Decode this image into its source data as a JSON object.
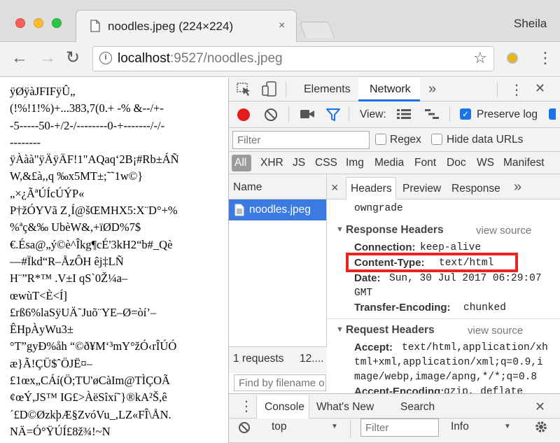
{
  "window": {
    "tab_title": "noodles.jpeg (224×224)",
    "tab_close": "×",
    "profile": "Sheila"
  },
  "toolbar": {
    "back": "←",
    "forward": "→",
    "reload": "↻",
    "url_host": "localhost",
    "url_rest": ":9527/noodles.jpeg",
    "star": "☆",
    "menu": "⋮",
    "info_icon": "i"
  },
  "page": {
    "lines": [
      "ÿØÿàJFIFÿÛ„",
      "(!%!1!%)+...383,7(0.+  -%  &--/+-",
      "-5-----50-+/2-/--------0-+-------/-/-",
      "--------",
      "ÿÀàà\"ÿÄÿÄF!1\"AQaq‘2B¡#Rb±ÁÑ",
      "W,&£à,,q ‰x5MT±;˜˜1w©}",
      "„×¿ÃªÚÍcÚÝP«",
      "P†žÓYVã  Z¸Í@šŒMHX5:X¨D°+%",
      "%ªç&‰  UbèW&,+ïØD%7$",
      "€.Ésa@„ý©è^Îkg¶cÉ'3kH2“b#_Qè",
      "—#Ïkd“R–ÅzÔH êj‡LÑ",
      "H¨”R*™ .V±I  qS`0Ž¼a–",
      "œwùT<È<Í]",
      "£rß6%laSÿUÄ˜Juõ¨YE–Ø=òí’–",
      "ÊHpÀyWu3±",
      "°T”gyÐ%åh  “©ð¥M‘³mY°žÓ‹rÎÚÓ",
      "æ}Ã!ÇÜ$ˆÖJË¤–",
      "£1œx„CÁí(Ö;TU'øCàIm@TÌÇOÃ",
      "¢œÝ,JS™ IG£>ÀëSîxí˜}®kA²Š,ê",
      "´£D©ØzkþÆ§ZvóVu_,LZ«FÎ\\ÅN.",
      "NÄ=Ó°ŸÚÍ£8ž¾!~N"
    ]
  },
  "devtools": {
    "tabs": [
      "Elements",
      "Network"
    ],
    "active_tab": "Network",
    "more": "»",
    "kebab": "⋮",
    "close": "✕",
    "view_label": "View:",
    "preserve_log": "Preserve log",
    "filter_placeholder": "Filter",
    "regex": "Regex",
    "hide_data_urls": "Hide data URLs",
    "types": [
      "All",
      "XHR",
      "JS",
      "CSS",
      "Img",
      "Media",
      "Font",
      "Doc",
      "WS",
      "Manifest"
    ],
    "name_col": "Name",
    "request_name": "noodles.jpeg",
    "detail_close": "×",
    "detail_tabs": [
      "Headers",
      "Preview",
      "Response"
    ],
    "requests_summary": "1 requests",
    "requests_more": "12....",
    "find_placeholder": "Find by filename o",
    "top_line": "owngrade",
    "response_headers_title": "Response Headers",
    "view_source": "view source",
    "response_headers": [
      {
        "key": "Connection:",
        "value": "keep-alive"
      },
      {
        "key": "Content-Type:",
        "value": "text/html"
      },
      {
        "key": "Date:",
        "value": "Sun, 30 Jul 2017 06:29:07"
      },
      {
        "key": "",
        "value": "GMT"
      },
      {
        "key": "Transfer-Encoding:",
        "value": "chunked"
      }
    ],
    "request_headers_title": "Request Headers",
    "request_headers": [
      {
        "key": "Accept:",
        "value": "text/html,application/xh"
      },
      {
        "key": "",
        "value": "tml+xml,application/xml;q=0.9,i"
      },
      {
        "key": "",
        "value": "mage/webp,image/apng,*/*;q=0.8"
      },
      {
        "key": "Accept-Encoding:",
        "value": "gzip, deflate"
      }
    ],
    "drawer": {
      "tabs": [
        "Console",
        "What's New",
        "Search"
      ],
      "active": "Console",
      "close": "✕",
      "context": "top",
      "filter_placeholder": "Filter",
      "level": "Info"
    },
    "highlight_color": "#e8261f",
    "accent_color": "#1a73e8"
  }
}
